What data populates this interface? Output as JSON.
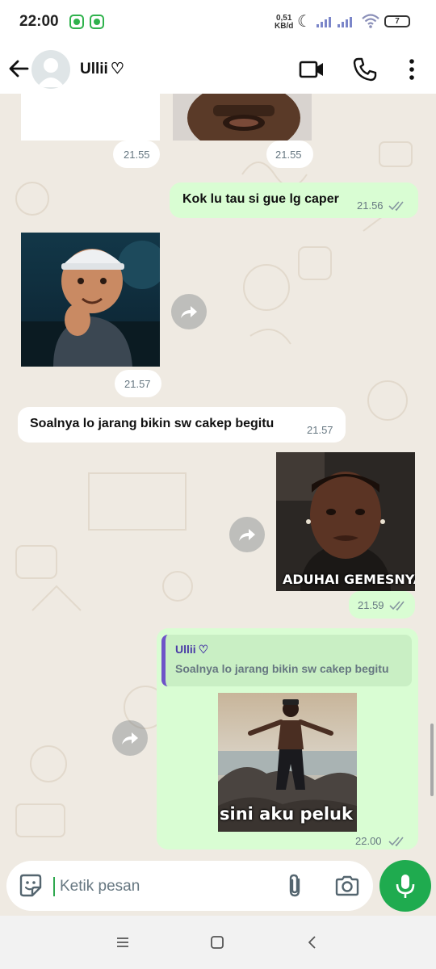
{
  "status_bar": {
    "time": "22:00",
    "net_speed_value": "0,51",
    "net_speed_unit": "KB/d",
    "battery": "7"
  },
  "header": {
    "contact_name": "Ullii",
    "heart_icon": "♡"
  },
  "messages": [
    {
      "id": "m1",
      "direction": "in",
      "type": "sticker",
      "time": "21.55"
    },
    {
      "id": "m2",
      "direction": "in",
      "type": "sticker",
      "time": "21.55"
    },
    {
      "id": "m3",
      "direction": "out",
      "type": "text",
      "text": "Kok lu tau si gue lg caper",
      "time": "21.56",
      "status": "read"
    },
    {
      "id": "m4",
      "direction": "in",
      "type": "sticker",
      "time": "21.57"
    },
    {
      "id": "m5",
      "direction": "in",
      "type": "text",
      "text": "Soalnya lo jarang bikin sw cakep begitu",
      "time": "21.57"
    },
    {
      "id": "m6",
      "direction": "out",
      "type": "sticker",
      "caption": "ADUHAI GEMESNYA",
      "time": "21.59",
      "status": "read"
    },
    {
      "id": "m7",
      "direction": "out",
      "type": "sticker-reply",
      "caption": "sini aku peluk",
      "time": "22.00",
      "status": "read",
      "quote": {
        "name": "Ullii",
        "text": "Soalnya lo jarang bikin sw cakep begitu"
      }
    }
  ],
  "input": {
    "placeholder": "Ketik pesan"
  },
  "colors": {
    "chat_bg": "#efeae2",
    "out_bubble": "#d9fdd3",
    "in_bubble": "#ffffff",
    "mic_button": "#1fab4f",
    "quote_bar": "#6e53c8",
    "read_ticks": "#8696a0"
  },
  "icons": [
    "back-arrow-icon",
    "video-call-icon",
    "voice-call-icon",
    "more-vert-icon",
    "forward-icon",
    "double-check-icon",
    "sticker-icon",
    "attach-icon",
    "camera-icon",
    "mic-icon",
    "nav-menu-icon",
    "nav-home-icon",
    "nav-back-icon"
  ]
}
